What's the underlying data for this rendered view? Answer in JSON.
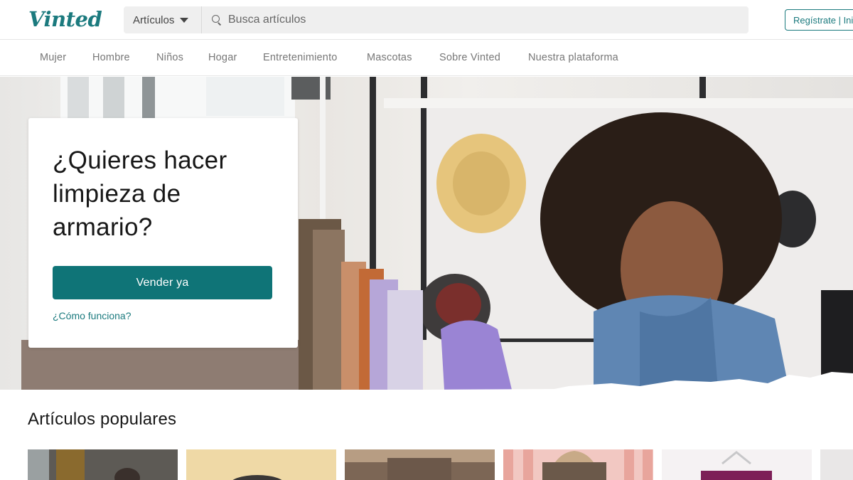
{
  "header": {
    "logo_text": "Vinted",
    "brand_color": "#1b7a7e",
    "search": {
      "category_label": "Artículos",
      "placeholder": "Busca artículos"
    },
    "auth_label": "Regístrate | Inicia sesión"
  },
  "nav": {
    "categories": [
      "Mujer",
      "Hombre",
      "Niños",
      "Hogar",
      "Entretenimiento",
      "Mascotas",
      "Sobre Vinted",
      "Nuestra plataforma"
    ]
  },
  "hero": {
    "title": "¿Quieres hacer limpieza de armario?",
    "cta_label": "Vender ya",
    "cta_color": "#0f7477",
    "help_link": "¿Cómo funciona?"
  },
  "popular": {
    "title": "Artículos populares"
  }
}
